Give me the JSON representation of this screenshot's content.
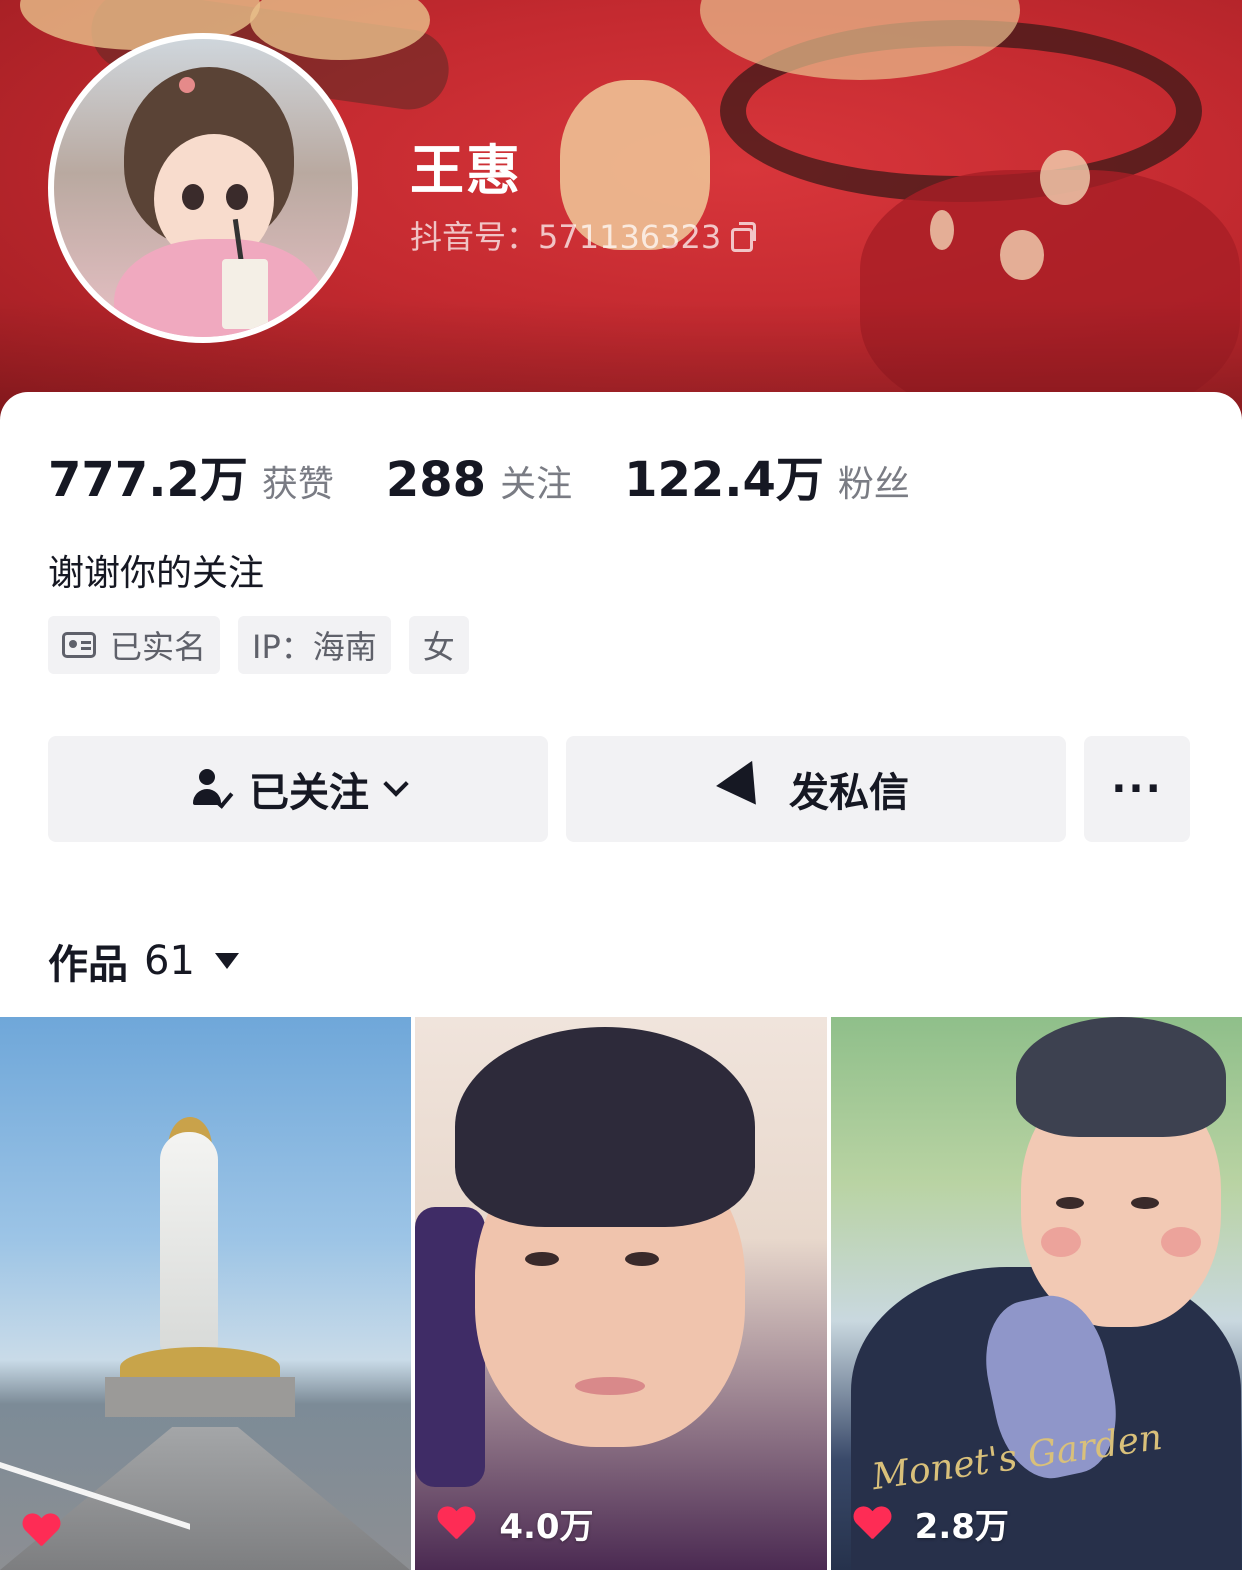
{
  "profile": {
    "name": "王惠",
    "douyin_id": "抖音号：571136323"
  },
  "stats": [
    {
      "value": "777.2万",
      "label": "获赞"
    },
    {
      "value": "288",
      "label": "关注"
    },
    {
      "value": "122.4万",
      "label": "粉丝"
    }
  ],
  "bio": "谢谢你的关注",
  "tags": {
    "verified": "已实名",
    "ip": "IP：海南",
    "gender": "女"
  },
  "actions": {
    "follow": "已关注",
    "message": "发私信",
    "more": "···"
  },
  "works": {
    "label": "作品",
    "count": "61"
  },
  "videos": [
    {
      "likes": ""
    },
    {
      "likes": "4.0万"
    },
    {
      "likes": "2.8万"
    }
  ],
  "watermark_text": "Monet's Garden",
  "colors": {
    "accent_red": "#fe2c55",
    "banner_red": "#c42a30"
  }
}
